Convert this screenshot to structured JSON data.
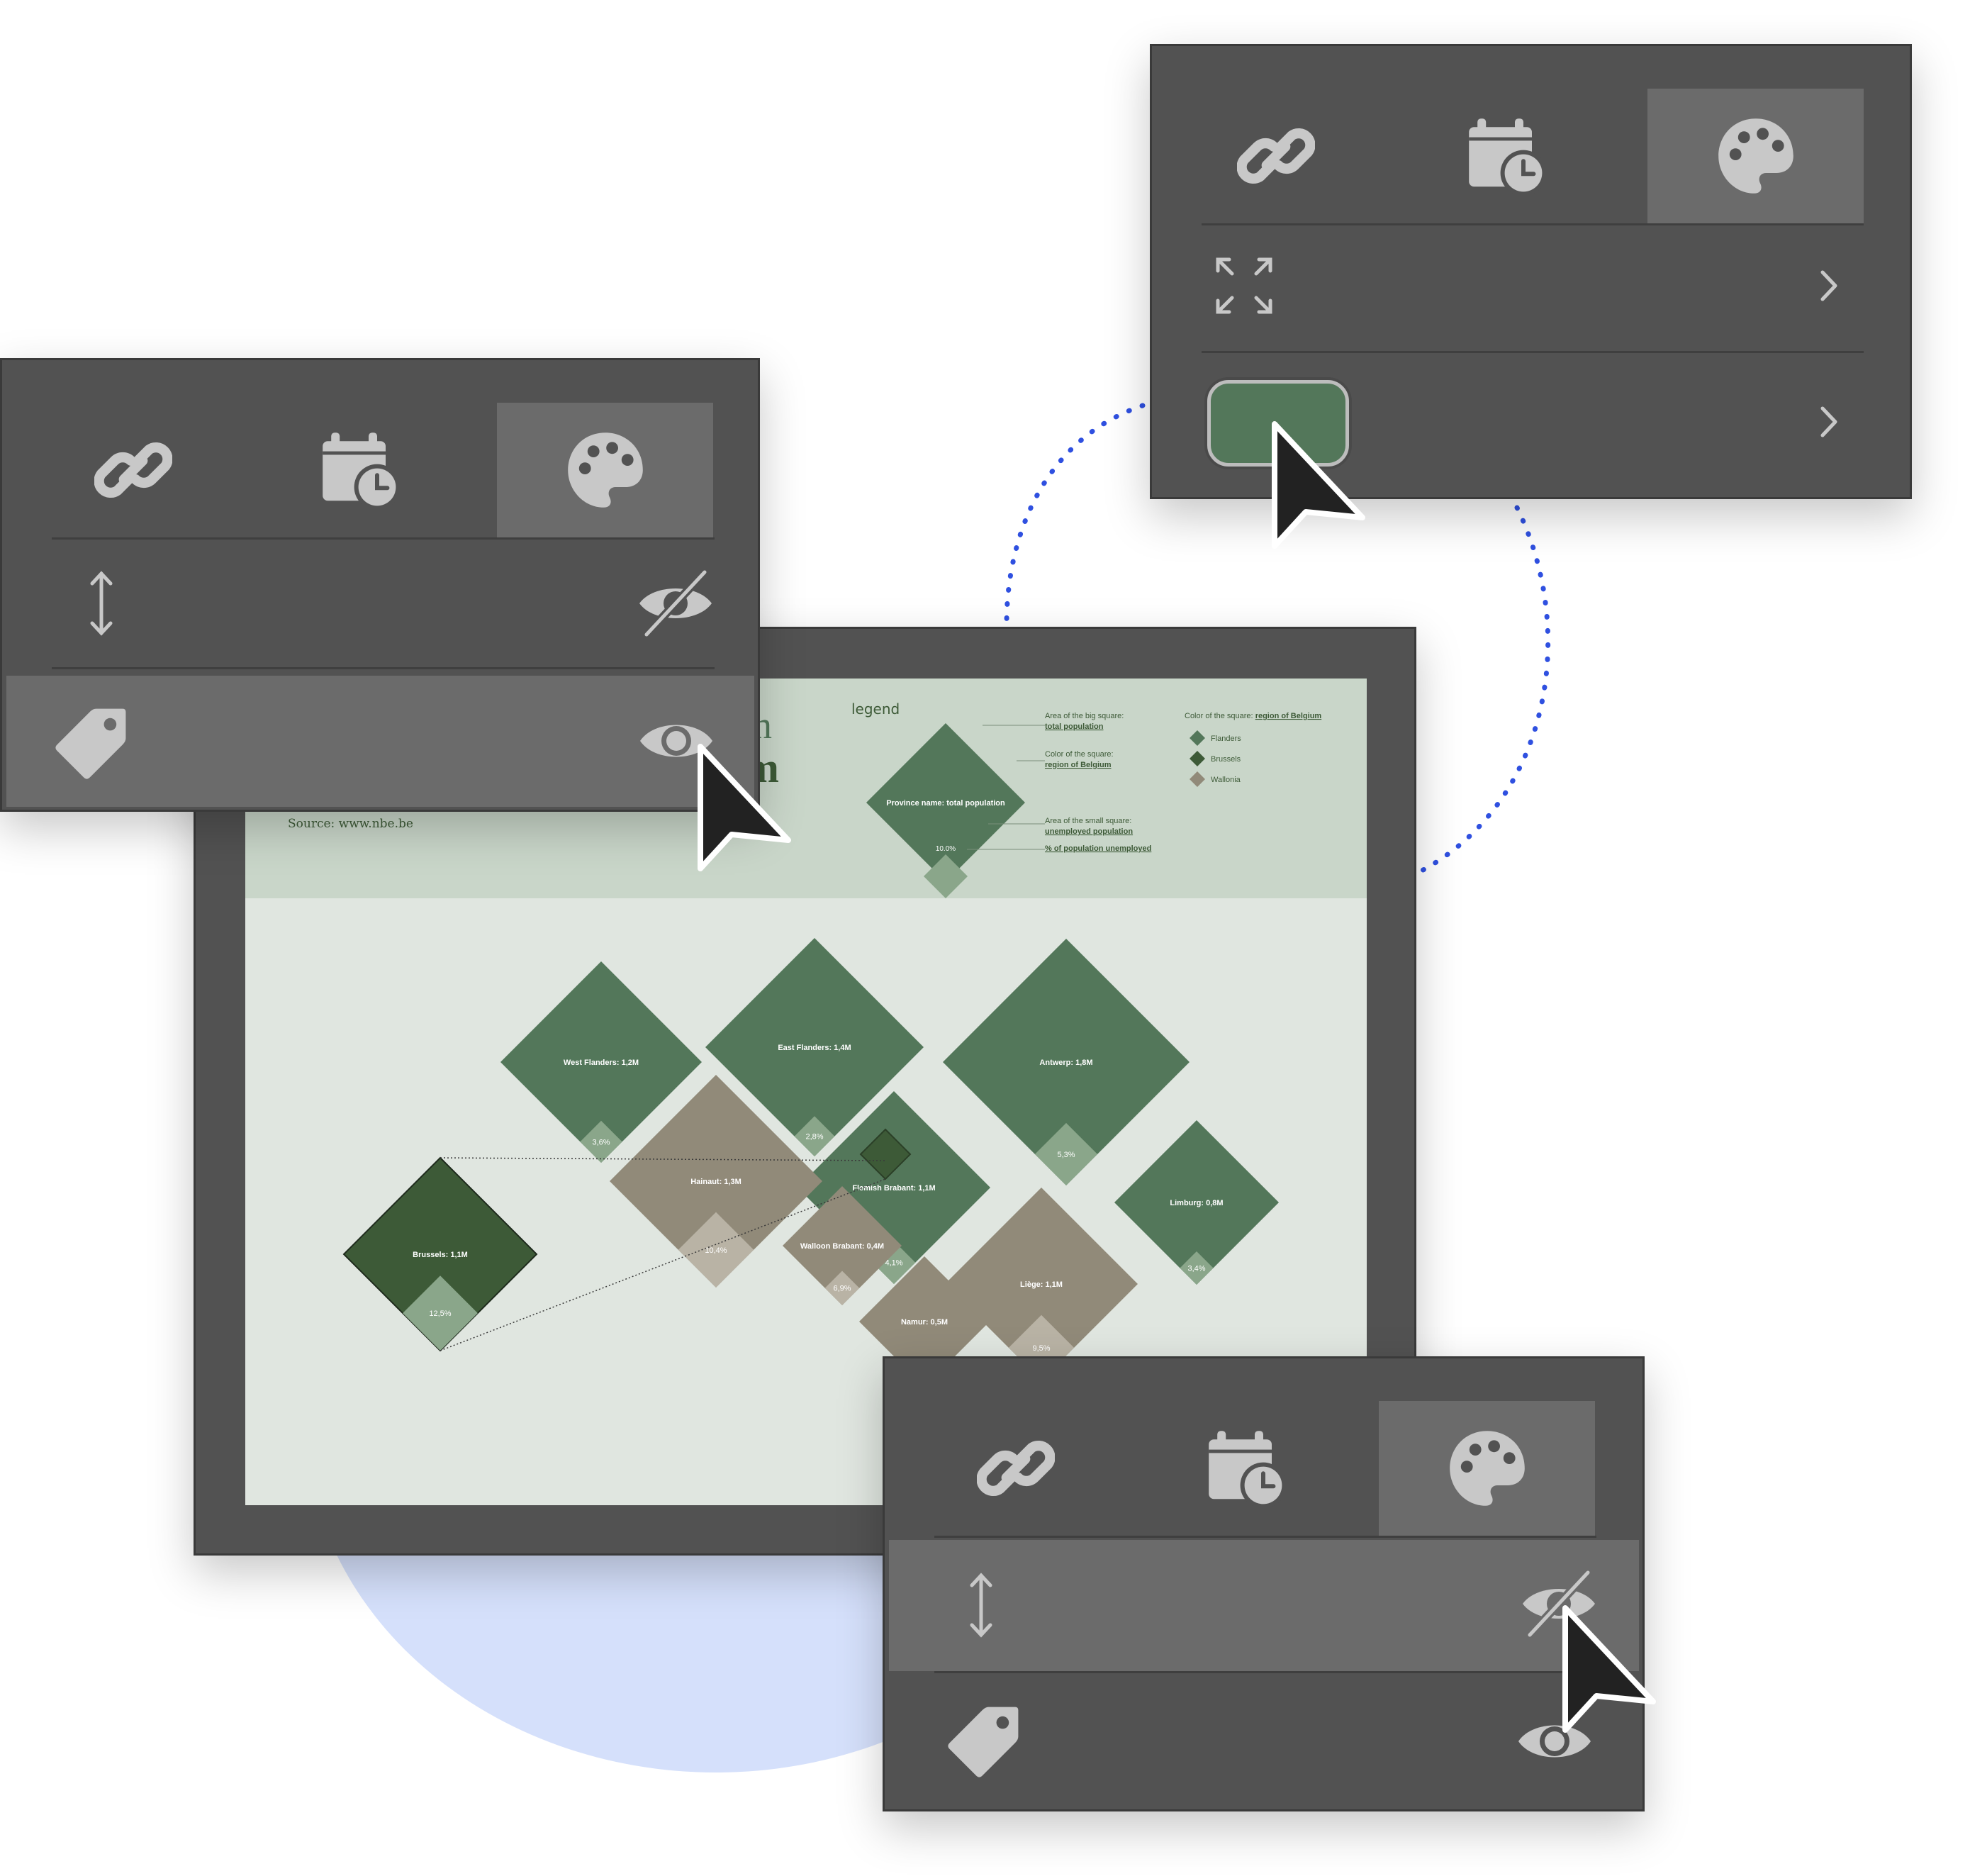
{
  "colors": {
    "flanders": "#53775a",
    "brussels": "#3d5a37",
    "wallonia": "#918a79",
    "panel_bg": "#525252",
    "panel_active": "#6b6b6b",
    "icon": "#c8c8c8",
    "accent_swatch": "#53775a",
    "orbit": "#2f50e0"
  },
  "toolbar": {
    "tabs": [
      {
        "name": "link",
        "icon": "link-icon"
      },
      {
        "name": "schedule",
        "icon": "calendar-clock-icon"
      },
      {
        "name": "style",
        "icon": "palette-icon",
        "active": true
      }
    ]
  },
  "panel_left": {
    "rows": [
      {
        "icon": "vertical-resize-icon",
        "right_icon": "eye-slash-icon"
      },
      {
        "icon": "tag-icon",
        "right_icon": "eye-icon",
        "highlighted": true
      }
    ]
  },
  "panel_top_right": {
    "rows": [
      {
        "icon": "expand-icon",
        "right_icon": "chevron-right-icon"
      },
      {
        "icon": "color-swatch",
        "right_icon": "chevron-right-icon"
      }
    ]
  },
  "panel_bottom_right": {
    "rows": [
      {
        "icon": "vertical-resize-icon",
        "right_icon": "eye-slash-icon",
        "highlighted": true
      },
      {
        "icon": "tag-icon",
        "right_icon": "eye-icon"
      }
    ]
  },
  "infographic": {
    "title_fragment_1": "n",
    "title_fragment_2": "m",
    "source": "Source: www.nbe.be",
    "legend": {
      "title": "legend",
      "sample_label": "Province name: total population",
      "sample_pct": "10.0%",
      "big_square_note": "Area of the big square:",
      "big_square_link": "total population",
      "color_note": "Color of the square:",
      "color_link": "region of Belgium",
      "small_square_note": "Area of the small square:",
      "small_square_link": "unemployed population",
      "pct_link": "% of population unemployed",
      "key_title": "Color of the square:",
      "key_title_link": "region of Belgium",
      "key_items": [
        {
          "label": "Flanders",
          "color": "#53775a"
        },
        {
          "label": "Brussels",
          "color": "#3d5a37"
        },
        {
          "label": "Wallonia",
          "color": "#918a79"
        }
      ]
    }
  },
  "chart_data": {
    "type": "diamond-treemap",
    "provinces": [
      {
        "name": "West Flanders",
        "label": "West Flanders: 1,2M",
        "population_m": 1.2,
        "unemployed_pct": 3.6,
        "pct_label": "3,6%",
        "region": "Flanders"
      },
      {
        "name": "East Flanders",
        "label": "East Flanders: 1,4M",
        "population_m": 1.4,
        "unemployed_pct": 2.8,
        "pct_label": "2,8%",
        "region": "Flanders"
      },
      {
        "name": "Antwerp",
        "label": "Antwerp: 1,8M",
        "population_m": 1.8,
        "unemployed_pct": 5.3,
        "pct_label": "5,3%",
        "region": "Flanders"
      },
      {
        "name": "Flemish Brabant",
        "label": "Flemish Brabant: 1,1M",
        "population_m": 1.1,
        "unemployed_pct": 4.1,
        "pct_label": "4,1%",
        "region": "Flanders"
      },
      {
        "name": "Limburg",
        "label": "Limburg: 0,8M",
        "population_m": 0.8,
        "unemployed_pct": 3.4,
        "pct_label": "3,4%",
        "region": "Flanders"
      },
      {
        "name": "Hainaut",
        "label": "Hainaut: 1,3M",
        "population_m": 1.3,
        "unemployed_pct": 10.4,
        "pct_label": "10,4%",
        "region": "Wallonia"
      },
      {
        "name": "Walloon Brabant",
        "label": "Walloon Brabant: 0,4M",
        "population_m": 0.4,
        "unemployed_pct": 6.9,
        "pct_label": "6,9%",
        "region": "Wallonia"
      },
      {
        "name": "Namur",
        "label": "Namur: 0,5M",
        "population_m": 0.5,
        "unemployed_pct": null,
        "pct_label": "",
        "region": "Wallonia"
      },
      {
        "name": "Liège",
        "label": "Liège: 1,1M",
        "population_m": 1.1,
        "unemployed_pct": 9.5,
        "pct_label": "9,5%",
        "region": "Wallonia"
      },
      {
        "name": "Brussels",
        "label": "Brussels: 1,1M",
        "population_m": 1.1,
        "unemployed_pct": 12.5,
        "pct_label": "12,5%",
        "region": "Brussels"
      }
    ]
  }
}
